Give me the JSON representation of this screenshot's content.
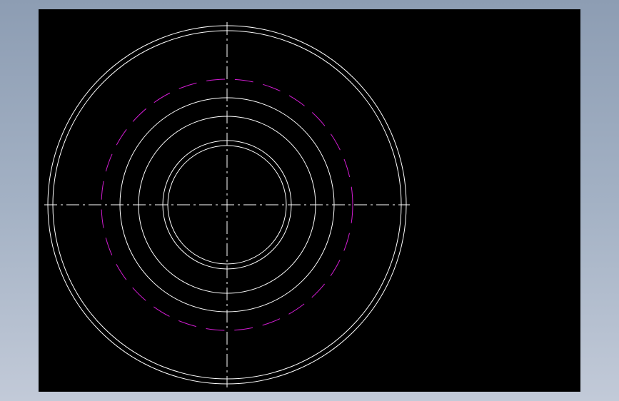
{
  "drawing": {
    "background_color": "#000000",
    "frame_color": "#9fadc1",
    "line_color": "#ffffff",
    "hidden_line_color": "#d21cd2",
    "center_line_color": "#ffffff",
    "view": "front",
    "circles": [
      {
        "id": "outer-rim-outer",
        "style": "solid"
      },
      {
        "id": "outer-rim-inner",
        "style": "solid"
      },
      {
        "id": "hidden-pitch",
        "style": "dashed"
      },
      {
        "id": "hub-outer",
        "style": "solid"
      },
      {
        "id": "hub-inner",
        "style": "solid"
      },
      {
        "id": "bore-outer",
        "style": "solid"
      },
      {
        "id": "bore-inner",
        "style": "solid"
      }
    ]
  }
}
